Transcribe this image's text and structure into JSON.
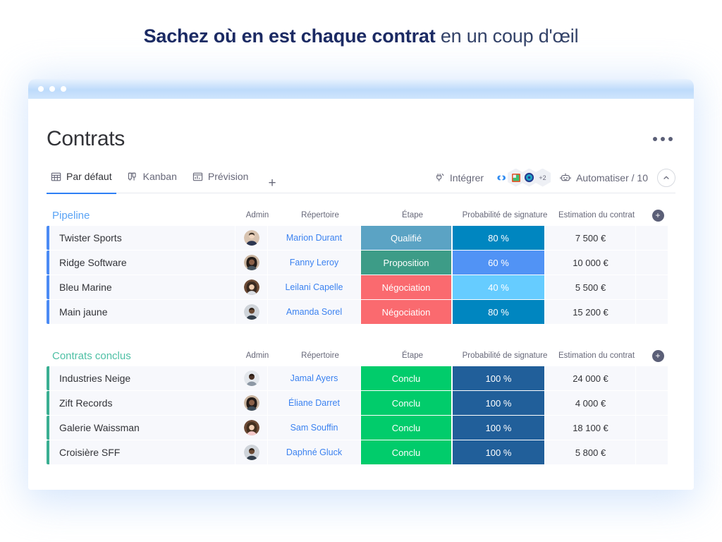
{
  "headline": {
    "strong": "Sachez où en est chaque contrat",
    "light": " en un coup d'œil"
  },
  "window": {
    "traffic_dots": 3
  },
  "board": {
    "title": "Contrats",
    "kebab_label": "...",
    "tabs": [
      {
        "label": "Par défaut",
        "icon": "table-grid-icon",
        "active": true
      },
      {
        "label": "Kanban",
        "icon": "kanban-columns-icon",
        "active": false
      },
      {
        "label": "Prévision",
        "icon": "forecast-chart-icon",
        "active": false
      }
    ],
    "add_tab_label": "+",
    "toolbar": {
      "integrate_label": "Intégrer",
      "integrate_icon": "plug-icon",
      "integration_badges": [
        "monday-icon",
        "excel-icon",
        "globe-icon"
      ],
      "integration_overflow": "+2",
      "automate_label": "Automatiser / 10",
      "automate_icon": "robot-icon",
      "collapse_icon": "chevron-up-icon"
    }
  },
  "columns": {
    "admin": "Admin",
    "repertoire": "Répertoire",
    "etape": "Étape",
    "probabilite": "Probabilité de signature",
    "estimation": "Estimation du contrat",
    "add": "+"
  },
  "colors": {
    "pipeline_accent": "#4b8bf4",
    "concluded_accent": "#3aaf92",
    "pipeline_title": "#5ba4f5",
    "concluded_title": "#4ec0a5",
    "stage_qualifie": "#5ba3c4",
    "stage_proposition": "#3d9c87",
    "stage_negociation": "#fa6a6f",
    "stage_conclu": "#01cc6b",
    "prob_80": "#0086c0",
    "prob_60": "#5193f5",
    "prob_40": "#66ccff",
    "prob_100": "#215f9a",
    "tab_underline": "#2f80f5",
    "link": "#3b82f0"
  },
  "groups": [
    {
      "name": "Pipeline",
      "accent": "blue",
      "rows": [
        {
          "name": "Twister Sports",
          "avatar": "avatar-male-1",
          "repertoire": "Marion Durant",
          "stage": "Qualifié",
          "stage_color": "#5ba3c4",
          "probability": "80 %",
          "prob_color": "#0086c0",
          "estimation": "7 500 €"
        },
        {
          "name": "Ridge Software",
          "avatar": "avatar-female-1",
          "repertoire": "Fanny Leroy",
          "stage": "Proposition",
          "stage_color": "#3d9c87",
          "probability": "60 %",
          "prob_color": "#5193f5",
          "estimation": "10 000 €"
        },
        {
          "name": "Bleu Marine",
          "avatar": "avatar-female-2",
          "repertoire": "Leilani Capelle",
          "stage": "Négociation",
          "stage_color": "#fa6a6f",
          "probability": "40 %",
          "prob_color": "#66ccff",
          "estimation": "5 500 €"
        },
        {
          "name": "Main jaune",
          "avatar": "avatar-male-2",
          "repertoire": "Amanda Sorel",
          "stage": "Négociation",
          "stage_color": "#fa6a6f",
          "probability": "80 %",
          "prob_color": "#0086c0",
          "estimation": "15 200 €"
        }
      ]
    },
    {
      "name": "Contrats conclus",
      "accent": "green",
      "rows": [
        {
          "name": "Industries Neige",
          "avatar": "avatar-male-3",
          "repertoire": "Jamal Ayers",
          "stage": "Conclu",
          "stage_color": "#01cc6b",
          "probability": "100 %",
          "prob_color": "#215f9a",
          "estimation": "24 000 €"
        },
        {
          "name": "Zift Records",
          "avatar": "avatar-female-3",
          "repertoire": "Éliane Darret",
          "stage": "Conclu",
          "stage_color": "#01cc6b",
          "probability": "100 %",
          "prob_color": "#215f9a",
          "estimation": "4 000 €"
        },
        {
          "name": "Galerie Waissman",
          "avatar": "avatar-female-4",
          "repertoire": "Sam Souffin",
          "stage": "Conclu",
          "stage_color": "#01cc6b",
          "probability": "100 %",
          "prob_color": "#215f9a",
          "estimation": "18 100 €"
        },
        {
          "name": "Croisière SFF",
          "avatar": "avatar-male-4",
          "repertoire": "Daphné Gluck",
          "stage": "Conclu",
          "stage_color": "#01cc6b",
          "probability": "100 %",
          "prob_color": "#215f9a",
          "estimation": "5 800 €"
        }
      ]
    }
  ]
}
